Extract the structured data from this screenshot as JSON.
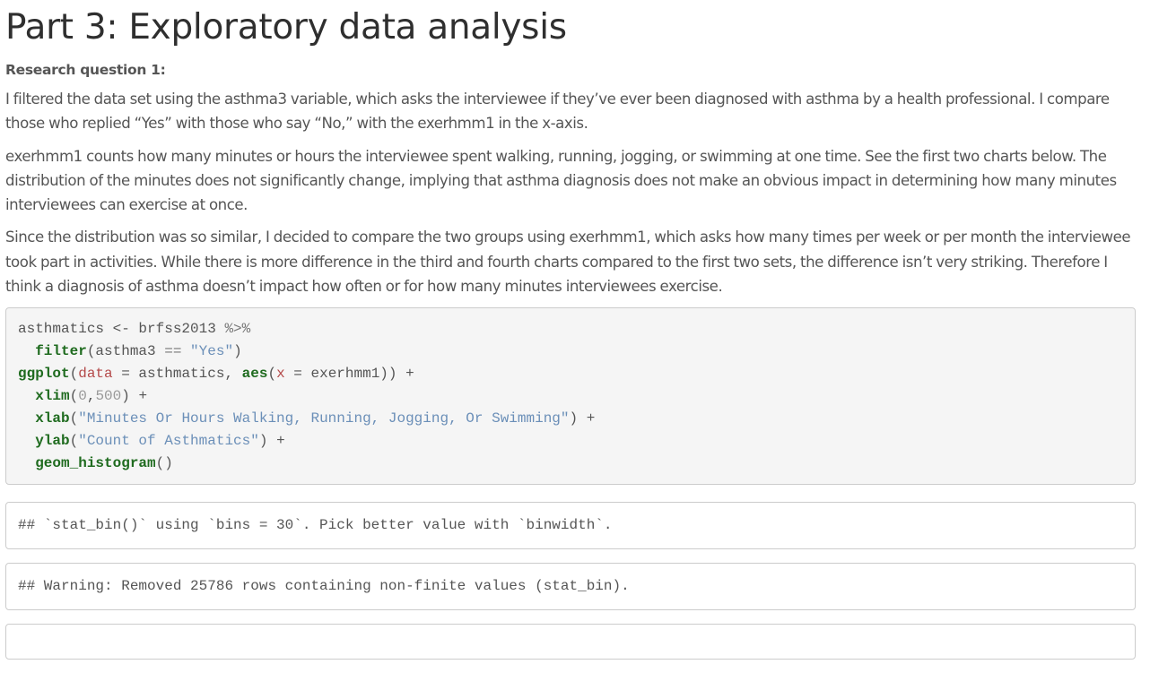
{
  "heading": "Part 3: Exploratory data analysis",
  "subheading": "Research question 1:",
  "paragraphs": [
    "I filtered the data set using the asthma3 variable, which asks the interviewee if they’ve ever been diagnosed with asthma by a health professional. I compare those who replied “Yes” with those who say “No,” with the exerhmm1 in the x-axis.",
    "exerhmm1 counts how many minutes or hours the interviewee spent walking, running, jogging, or swimming at one time. See the first two charts below. The distribution of the minutes does not significantly change, implying that asthma diagnosis does not make an obvious impact in determining how many minutes interviewees can exercise at once.",
    "Since the distribution was so similar, I decided to compare the two groups using exerhmm1, which asks how many times per week or per month the interviewee took part in activities. While there is more difference in the third and fourth charts compared to the first two sets, the difference isn’t very striking. Therefore I think a diagnosis of asthma doesn’t impact how often or for how many minutes interviewees exercise."
  ],
  "code": {
    "line1": {
      "var": "asthmatics",
      "assign": " <- ",
      "src": "brfss2013",
      "pipe": " %>%"
    },
    "line2": {
      "indent": "  ",
      "fn": "filter",
      "open": "(asthma3 ",
      "eq": "==",
      "sp": " ",
      "str": "\"Yes\"",
      "close": ")"
    },
    "line3": {
      "fn": "ggplot",
      "open": "(",
      "arg": "data",
      "eq": " = asthmatics, ",
      "fn2": "aes",
      "open2": "(",
      "arg2": "x",
      "rest": " = exerhmm1)) +"
    },
    "line4": {
      "indent": "  ",
      "fn": "xlim",
      "open": "(",
      "num1": "0",
      "comma": ",",
      "num2": "500",
      "close": ") +"
    },
    "line5": {
      "indent": "  ",
      "fn": "xlab",
      "open": "(",
      "str": "\"Minutes Or Hours Walking, Running, Jogging, Or Swimming\"",
      "close": ") +"
    },
    "line6": {
      "indent": "  ",
      "fn": "ylab",
      "open": "(",
      "str": "\"Count of Asthmatics\"",
      "close": ") +"
    },
    "line7": {
      "indent": "  ",
      "fn": "geom_histogram",
      "close": "()"
    }
  },
  "outputs": [
    "## `stat_bin()` using `bins = 30`. Pick better value with `binwidth`.",
    "## Warning: Removed 25786 rows containing non-finite values (stat_bin)."
  ]
}
